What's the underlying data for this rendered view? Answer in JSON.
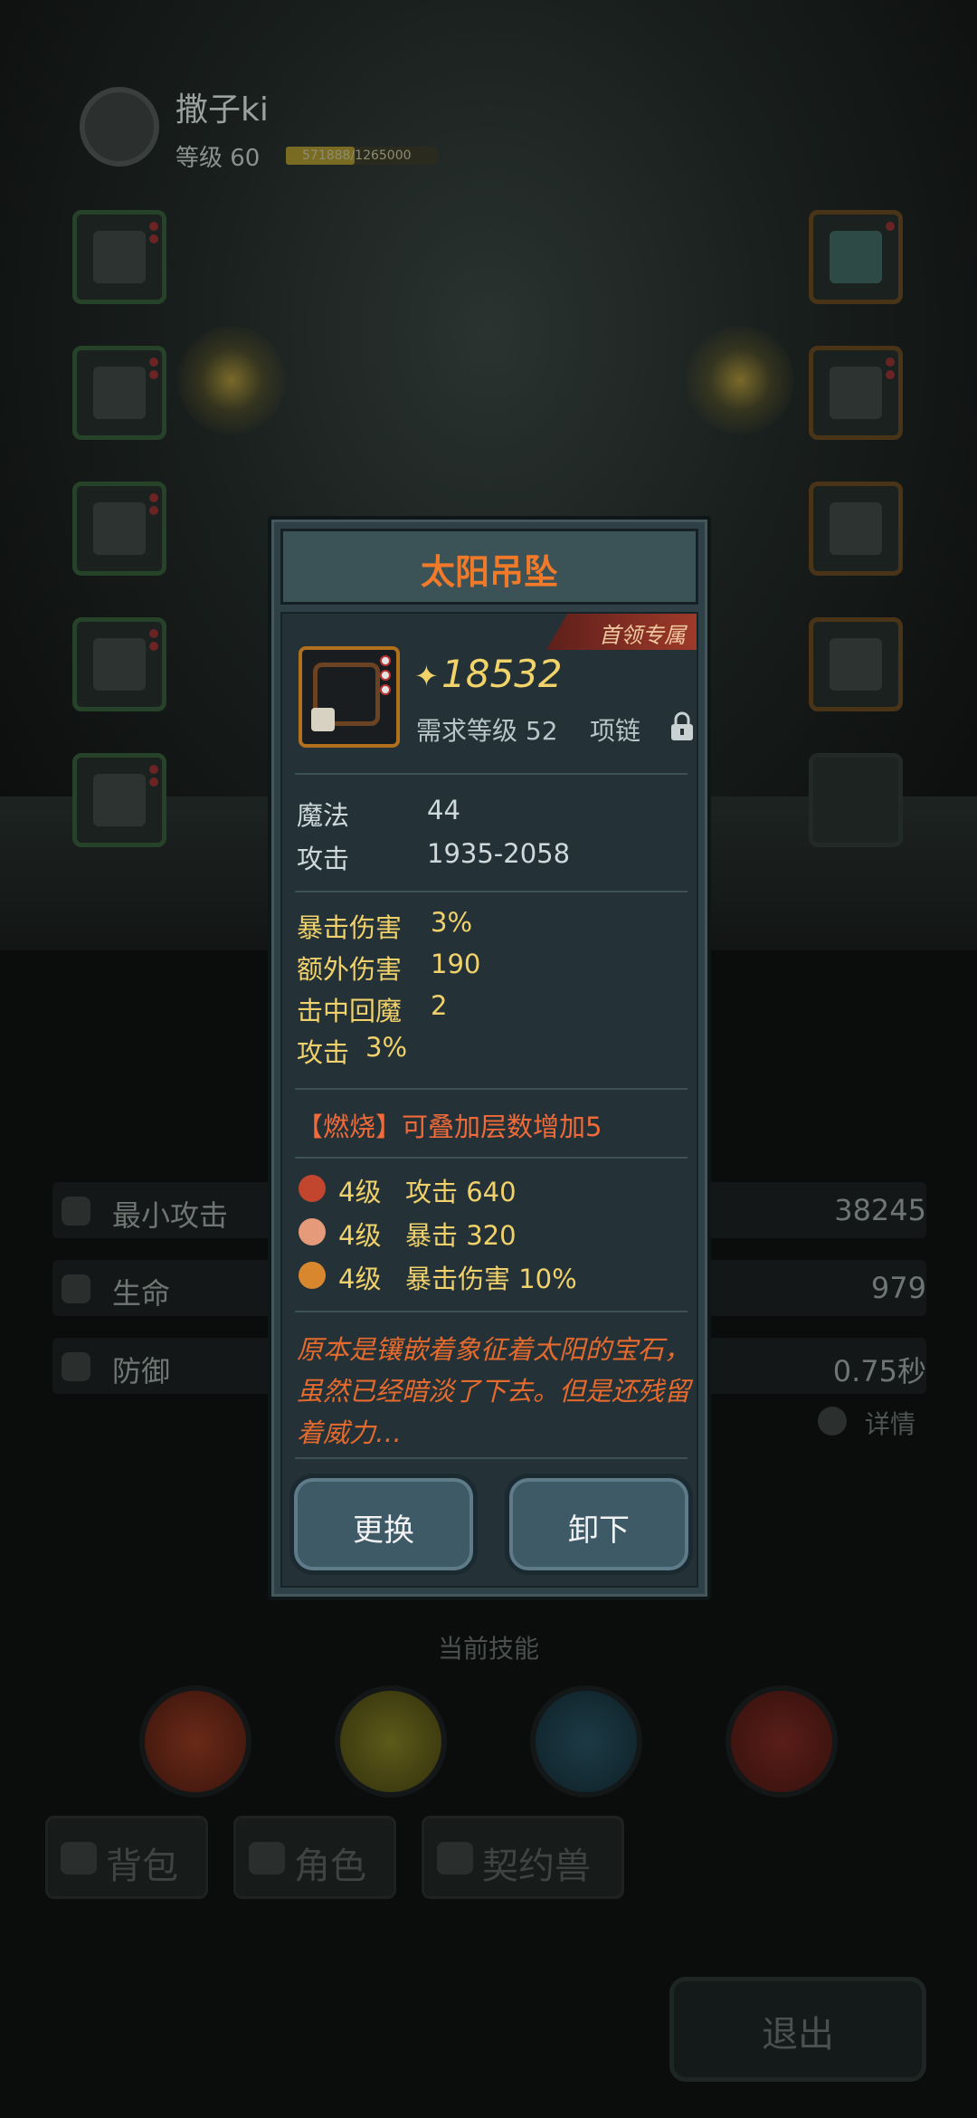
{
  "player": {
    "name": "撒子ki",
    "level_label": "等级 60",
    "xp_text": "571888/1265000",
    "xp_progress": 0.45
  },
  "stats": [
    {
      "label": "最小攻击",
      "value": "38245",
      "icon": "sword-icon"
    },
    {
      "label": "生命",
      "value": "979",
      "icon": "heart-icon"
    },
    {
      "label": "防御",
      "value": "0.75秒",
      "icon": "shield-icon"
    }
  ],
  "detail_label": "详情",
  "skills_title": "当前技能",
  "tabs": [
    "背包",
    "角色",
    "契约兽"
  ],
  "exit_label": "退出",
  "item": {
    "name": "太阳吊坠",
    "badge": "首领专属",
    "power": "18532",
    "required_level": "需求等级 52",
    "type": "项链",
    "base_stats": [
      {
        "label": "魔法",
        "value": "44"
      },
      {
        "label": "攻击",
        "value": "1935-2058"
      }
    ],
    "bonus_stats": [
      {
        "label": "暴击伤害",
        "value": "3%"
      },
      {
        "label": "额外伤害",
        "value": "190"
      },
      {
        "label": "击中回魔",
        "value": "2"
      },
      {
        "label": "攻击",
        "value": "3%"
      }
    ],
    "special": "【燃烧】可叠加层数增加5",
    "gems": [
      {
        "level": "4级",
        "effect": "攻击 640",
        "color": "#c2452e"
      },
      {
        "level": "4级",
        "effect": "暴击 320",
        "color": "#e59a7a"
      },
      {
        "level": "4级",
        "effect": "暴击伤害 10%",
        "color": "#d8872f"
      }
    ],
    "flavor": "原本是镶嵌着象征着太阳的宝石，虽然已经暗淡了下去。但是还残留着威力…",
    "replace_label": "更换",
    "unequip_label": "卸下"
  }
}
